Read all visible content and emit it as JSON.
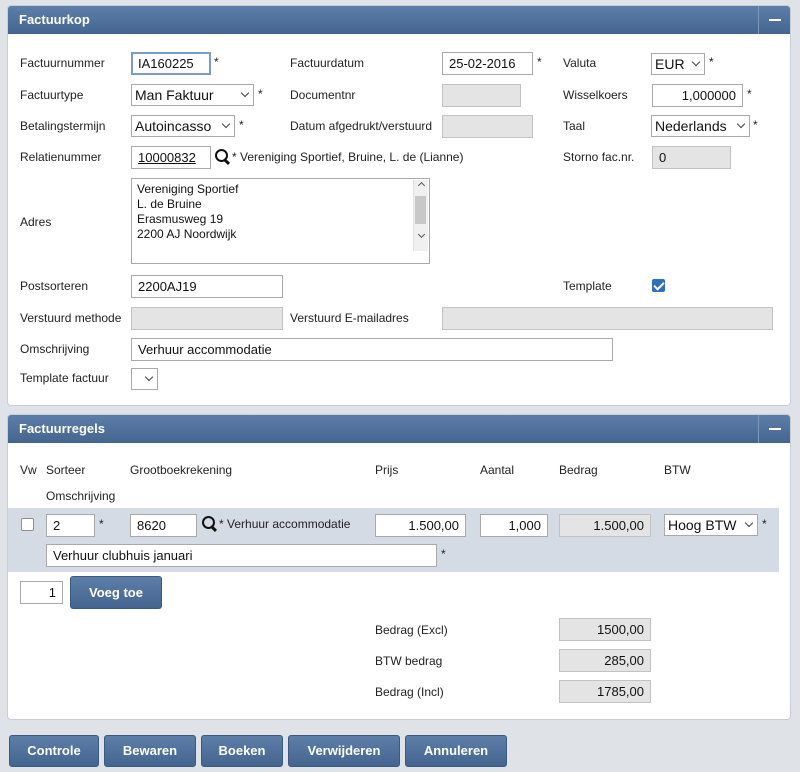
{
  "header": {
    "title": "Factuurkop",
    "factuurnummer_label": "Factuurnummer",
    "factuurnummer_value": "IA160225",
    "factuurdatum_label": "Factuurdatum",
    "factuurdatum_value": "25-02-2016",
    "valuta_label": "Valuta",
    "valuta_value": "EUR",
    "factuurtype_label": "Factuurtype",
    "factuurtype_value": "Man Faktuur",
    "documentnr_label": "Documentnr",
    "documentnr_value": "",
    "wisselkoers_label": "Wisselkoers",
    "wisselkoers_value": "1,000000",
    "betalingstermijn_label": "Betalingstermijn",
    "betalingstermijn_value": "Autoincasso",
    "datum_afgedrukt_label": "Datum afgedrukt/verstuurd",
    "datum_afgedrukt_value": "",
    "taal_label": "Taal",
    "taal_value": "Nederlands",
    "relatienummer_label": "Relatienummer",
    "relatienummer_value": "10000832",
    "relatie_naam": "* Vereniging Sportief, Bruine, L. de (Lianne)",
    "storno_label": "Storno fac.nr.",
    "storno_value": "0",
    "adres_label": "Adres",
    "adres_lines": [
      "Vereniging Sportief",
      "L. de Bruine",
      "Erasmusweg 19",
      "2200 AJ Noordwijk"
    ],
    "postsorteren_label": "Postsorteren",
    "postsorteren_value": "2200AJ19",
    "template_label": "Template",
    "template_checked": true,
    "verstuurd_methode_label": "Verstuurd methode",
    "verstuurd_methode_value": "",
    "verstuurd_email_label": "Verstuurd E-mailadres",
    "verstuurd_email_value": "",
    "omschrijving_label": "Omschrijving",
    "omschrijving_value": "Verhuur accommodatie",
    "template_factuur_label": "Template factuur",
    "template_factuur_value": "",
    "required_mark": "*"
  },
  "lines": {
    "title": "Factuurregels",
    "columns": {
      "vw": "Vw",
      "sorteer": "Sorteer",
      "grootboek": "Grootboekrekening",
      "prijs": "Prijs",
      "aantal": "Aantal",
      "bedrag": "Bedrag",
      "btw": "BTW",
      "omschrijving": "Omschrijving"
    },
    "rows": [
      {
        "sorteer": "2",
        "grootboek": "8620",
        "grootboek_naam": "* Verhuur accommodatie",
        "prijs": "1.500,00",
        "aantal": "1,000",
        "bedrag": "1.500,00",
        "btw": "Hoog BTW",
        "omschrijving": "Verhuur clubhuis januari"
      }
    ],
    "add_count": "1",
    "add_label": "Voeg toe",
    "totals": {
      "excl_label": "Bedrag (Excl)",
      "excl_value": "1500,00",
      "btw_label": "BTW bedrag",
      "btw_value": "285,00",
      "incl_label": "Bedrag (Incl)",
      "incl_value": "1785,00"
    }
  },
  "actions": {
    "controle": "Controle",
    "bewaren": "Bewaren",
    "boeken": "Boeken",
    "verwijderen": "Verwijderen",
    "annuleren": "Annuleren"
  },
  "colors": {
    "header_bg": "#4e6f98",
    "page_bg": "#dfe3e8",
    "row_band": "#d4dbe5",
    "checkbox_accent": "#2f6fbf"
  }
}
